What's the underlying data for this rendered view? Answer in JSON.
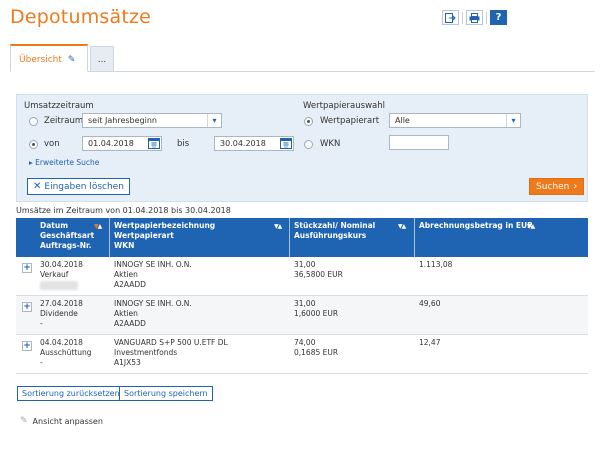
{
  "page": {
    "title": "Depotumsätze"
  },
  "toolbar": {
    "icons": [
      "export-icon",
      "print-icon",
      "help-icon"
    ],
    "help_label": "?"
  },
  "tabs": [
    {
      "label": "Übersicht",
      "active": true
    },
    {
      "label": "...",
      "active": false
    }
  ],
  "filter": {
    "umsatz_heading": "Umsatzzeitraum",
    "zeitraum_label": "Zeitraum",
    "zeitraum_value": "seit Jahresbeginn",
    "von_label": "von",
    "von_value": "01.04.2018",
    "bis_label": "bis",
    "bis_value": "30.04.2018",
    "erweiterte_suche": "Erweiterte Suche",
    "wp_heading": "Wertpapierauswahl",
    "wpart_label": "Wertpapierart",
    "wpart_value": "Alle",
    "wkn_label": "WKN",
    "wkn_value": "",
    "reset_label": "Eingaben löschen",
    "search_label": "Suchen"
  },
  "summary": "Umsätze im Zeitraum von 01.04.2018 bis 30.04.2018",
  "table": {
    "headers": [
      [
        "Datum",
        "Geschäftsart",
        "Auftrags-Nr."
      ],
      [
        "Wertpapierbezeichnung",
        "Wertpapierart",
        "WKN"
      ],
      [
        "Stückzahl/ Nominal",
        "Ausführungskurs"
      ],
      [
        "Abrechnungsbetrag in EUR"
      ]
    ],
    "rows": [
      {
        "datum": "30.04.2018",
        "art": "Verkauf",
        "auftrag": "",
        "bez": "INNOGY SE INH. O.N.",
        "wpart": "Aktien",
        "wkn": "A2AADD",
        "stueck": "31,00",
        "kurs": "36,5800 EUR",
        "betrag": "1.113,08"
      },
      {
        "datum": "27.04.2018",
        "art": "Dividende",
        "auftrag": "-",
        "bez": "INNOGY SE INH. O.N.",
        "wpart": "Aktien",
        "wkn": "A2AADD",
        "stueck": "31,00",
        "kurs": "1,6000 EUR",
        "betrag": "49,60"
      },
      {
        "datum": "04.04.2018",
        "art": "Ausschüttung",
        "auftrag": "-",
        "bez": "VANGUARD S+P 500 U.ETF DL",
        "wpart": "Investmentfonds",
        "wkn": "A1JX53",
        "stueck": "74,00",
        "kurs": "0,1685 EUR",
        "betrag": "12,47"
      }
    ]
  },
  "actions": {
    "reset_sort": "Sortierung zurücksetzen",
    "save_sort": "Sortierung speichern",
    "customize_view": "Ansicht anpassen"
  },
  "colors": {
    "accent_orange": "#ee7a1c",
    "primary_blue": "#1f63b3",
    "panel_bg": "#e6eef7"
  }
}
